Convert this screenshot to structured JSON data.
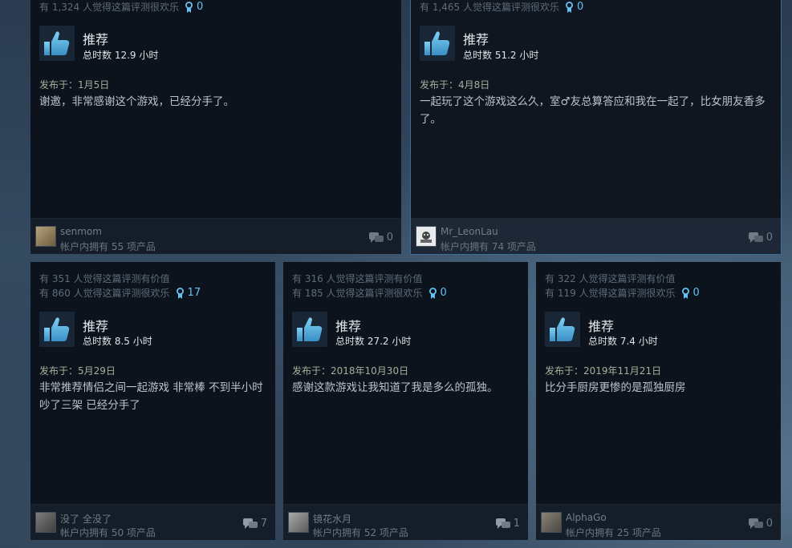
{
  "reviews": [
    {
      "helpful_text": "",
      "funny_text": "有 1,324 人觉得这篇评测很欢乐",
      "awards": "0",
      "verdict": "推荐",
      "hours": "总时数 12.9 小时",
      "posted": "发布于：1月5日",
      "content": "谢邀，非常感谢这个游戏，已经分手了。",
      "author": "senmom",
      "products": "帐户内拥有 55 项产品",
      "comments": "0"
    },
    {
      "helpful_text": "",
      "funny_text": "有 1,465 人觉得这篇评测很欢乐",
      "awards": "0",
      "verdict": "推荐",
      "hours": "总时数 51.2 小时",
      "posted": "发布于：4月8日",
      "content": "一起玩了这个游戏这么久，室♂友总算答应和我在一起了，比女朋友香多了。",
      "author": "Mr_LeonLau",
      "products": "帐户内拥有 74 项产品",
      "comments": "0"
    },
    {
      "helpful_text": "有 351 人觉得这篇评测有价值",
      "funny_text": "有 860 人觉得这篇评测很欢乐",
      "awards": "17",
      "verdict": "推荐",
      "hours": "总时数 8.5 小时",
      "posted": "发布于：5月29日",
      "content": "非常推荐情侣之间一起游戏 非常棒 不到半小时 吵了三架 已经分手了",
      "author": "没了 全没了",
      "products": "帐户内拥有 50 项产品",
      "comments": "7"
    },
    {
      "helpful_text": "有 316 人觉得这篇评测有价值",
      "funny_text": "有 185 人觉得这篇评测很欢乐",
      "awards": "0",
      "verdict": "推荐",
      "hours": "总时数 27.2 小时",
      "posted": "发布于：2018年10月30日",
      "content": "感谢这款游戏让我知道了我是多么的孤独。",
      "author": "镜花水月",
      "products": "帐户内拥有 52 项产品",
      "comments": "1"
    },
    {
      "helpful_text": "有 322 人觉得这篇评测有价值",
      "funny_text": "有 119 人觉得这篇评测很欢乐",
      "awards": "0",
      "verdict": "推荐",
      "hours": "总时数 7.4 小时",
      "posted": "发布于：2019年11月21日",
      "content": "比分手厨房更惨的是孤独厨房",
      "author": "AlphaGo",
      "products": "帐户内拥有 25 项产品",
      "comments": "0"
    }
  ],
  "icons": {
    "thumbs_up": "thumbs-up-icon",
    "award": "award-ribbon-icon",
    "comment": "comment-bubble-icon"
  },
  "colors": {
    "accent": "#66c0f4",
    "card_bg": "#0d131c",
    "posted": "#a5b09a"
  }
}
